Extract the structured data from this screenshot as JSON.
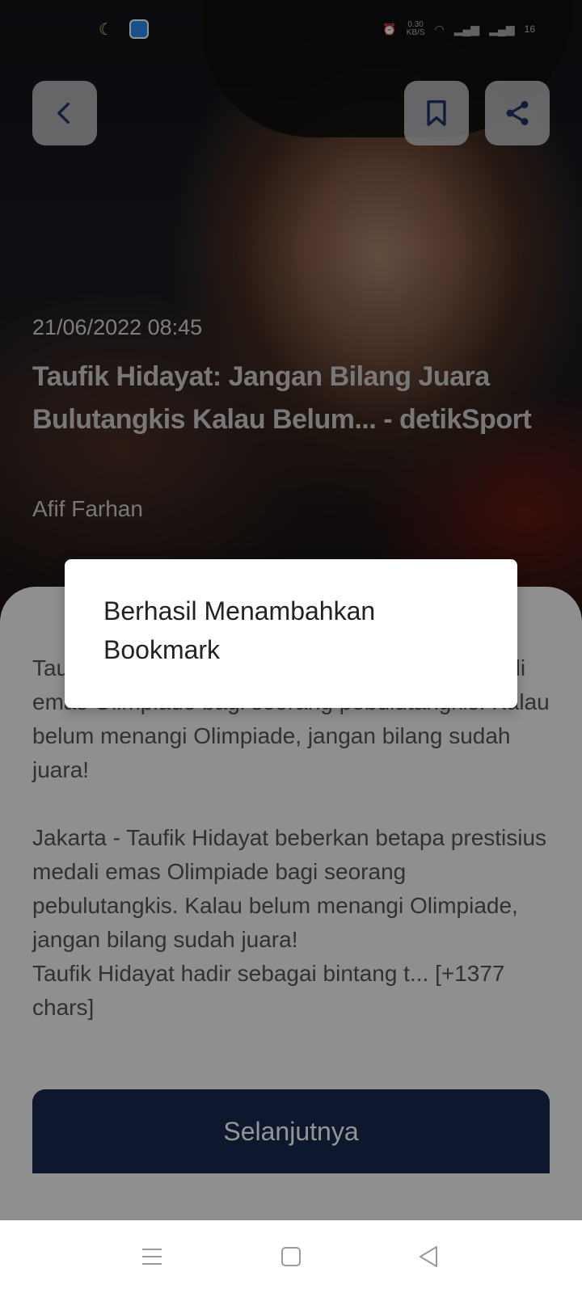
{
  "status_bar": {
    "network_speed": "0.30\nKB/S",
    "battery": "16"
  },
  "article": {
    "date": "21/06/2022 08:45",
    "title": "Taufik Hidayat: Jangan Bilang Juara Bulutangkis Kalau Belum... - detikSport",
    "author": "Afif Farhan",
    "body": "Taufik Hidayat beberkan betapa prestisius medali emas Olimpiade bagi seorang pebulutangkis. Kalau belum menangi Olimpiade, jangan bilang sudah juara!\n\nJakarta - Taufik Hidayat beberkan betapa prestisius medali emas Olimpiade bagi seorang pebulutangkis. Kalau belum menangi Olimpiade, jangan bilang sudah juara!\nTaufik Hidayat hadir sebagai bintang t... [+1377 chars]",
    "next_label": "Selanjutnya"
  },
  "dialog": {
    "message": "Berhasil Menambahkan Bookmark"
  },
  "icons": {
    "back": "chevron-left-icon",
    "bookmark": "bookmark-icon",
    "share": "share-icon"
  },
  "colors": {
    "primary": "#18284f",
    "card_bg": "#f6f6f6",
    "icon": "#1f3264"
  }
}
